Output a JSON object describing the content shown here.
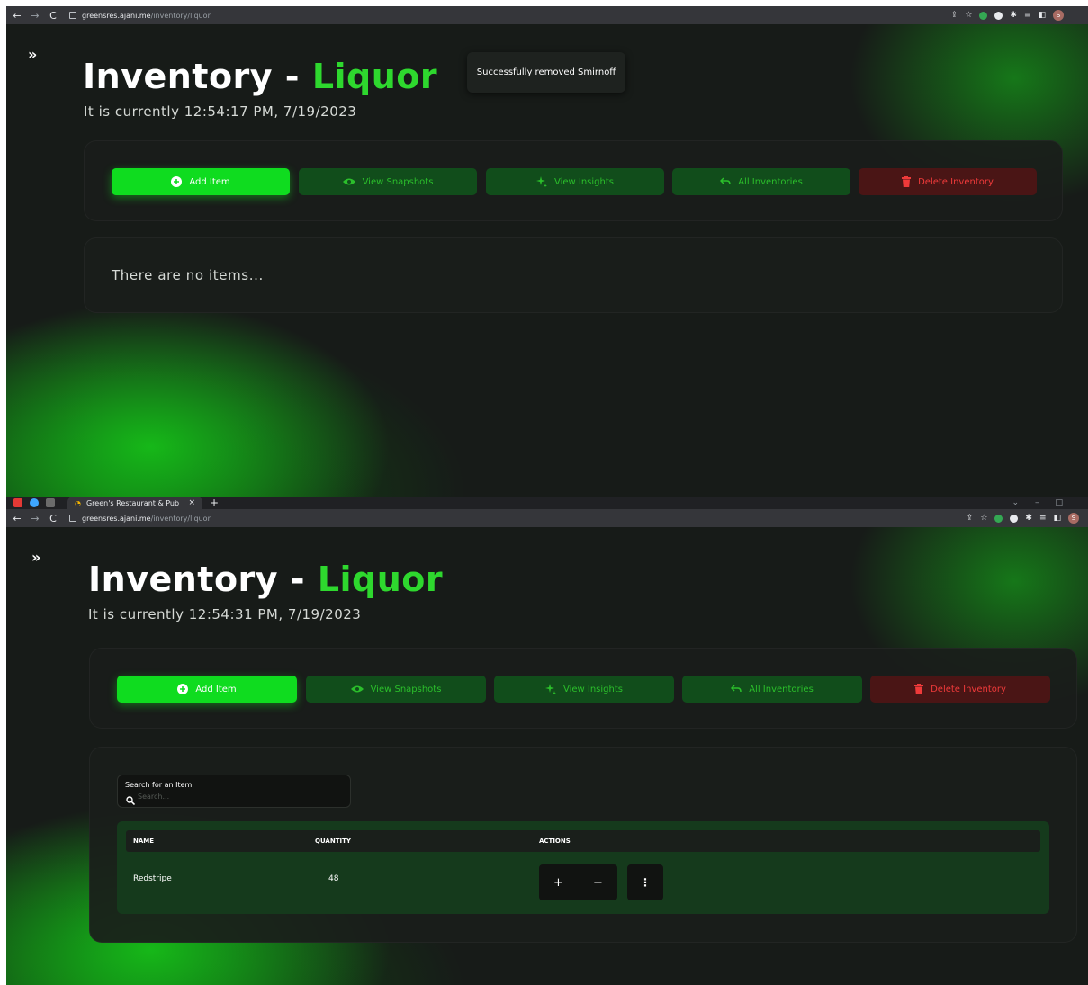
{
  "browser": {
    "url_host": "greensres.ajani.me",
    "url_path": "/inventory/liquor",
    "tab_title": "Green's Restaurant & Pub",
    "tab_close": "×",
    "new_tab": "+",
    "profile_initial": "S"
  },
  "page": {
    "title_prefix": "Inventory - ",
    "title_accent": "Liquor",
    "expand_label": "»"
  },
  "actions": {
    "add_item": "Add Item",
    "view_snapshots": "View Snapshots",
    "view_insights": "View Insights",
    "all_inventories": "All Inventories",
    "delete_inventory": "Delete Inventory"
  },
  "screen1": {
    "clock": "It is currently 12:54:17 PM, 7/19/2023",
    "toast": "Successfully removed Smirnoff",
    "empty_message": "There are no items..."
  },
  "screen2": {
    "clock": "It is currently 12:54:31 PM, 7/19/2023",
    "search": {
      "label": "Search for an Item",
      "placeholder": "Search..."
    },
    "table": {
      "headers": [
        "NAME",
        "QUANTITY",
        "ACTIONS"
      ],
      "rows": [
        {
          "name": "Redstripe",
          "quantity": "48"
        }
      ],
      "increment": "+",
      "decrement": "−",
      "more": "⋮"
    }
  },
  "colors": {
    "accent_green": "#2ed82e",
    "primary_button": "#0fdc1f",
    "secondary_button": "#114d1b",
    "danger_button": "#4a1515",
    "danger_text": "#ef3a3a"
  }
}
